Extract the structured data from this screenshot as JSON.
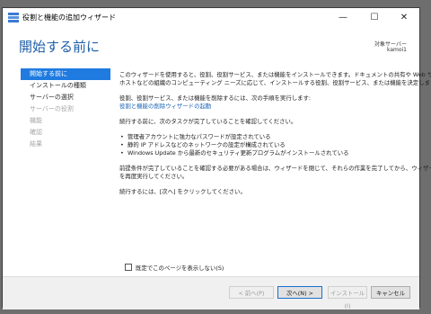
{
  "window": {
    "title": "役割と機能の追加ウィザード",
    "minimize": "—",
    "maximize": "☐",
    "close": "✕"
  },
  "header": {
    "page_title": "開始する前に",
    "server_label": "対象サーバー",
    "server_name": "kamoi1"
  },
  "nav": {
    "items": [
      {
        "label": "開始する前に",
        "state": "active"
      },
      {
        "label": "インストールの種類",
        "state": "enabled"
      },
      {
        "label": "サーバーの選択",
        "state": "enabled"
      },
      {
        "label": "サーバーの役割",
        "state": "disabled"
      },
      {
        "label": "機能",
        "state": "disabled"
      },
      {
        "label": "確認",
        "state": "disabled"
      },
      {
        "label": "結果",
        "state": "disabled"
      }
    ]
  },
  "main": {
    "intro_line1": "このウィザードを使用すると、役割、役割サービス、または機能をインストールできます。ドキュメントの共有や Web サイトの",
    "intro_line2": "ホストなどの組織のコンピューティング ニーズに応じて、インストールする役割、役割サービス、または機能を決定します。",
    "remove_text": "役割、役割サービス、または機能を削除するには、次の手順を実行します:",
    "remove_link": "役割と機能の削除ウィザードの起動",
    "tasks_intro": "続行する前に、次のタスクが完了していることを確認してください。",
    "bullets": [
      "管理者アカウントに強力なパスワードが設定されている",
      "静的 IP アドレスなどのネットワークの設定が構成されている",
      "Windows Update から最新のセキュリティ更新プログラムがインストールされている"
    ],
    "prereq_line1": "前提条件が完了していることを確認する必要がある場合は、ウィザードを閉じて、それらの作業を完了してから、ウィザード",
    "prereq_line2": "を再度実行してください。",
    "continue_text": "続行するには、[次へ] をクリックしてください。",
    "skip_checkbox": "既定でこのページを表示しない(S)"
  },
  "footer": {
    "prev": "< 前へ(P)",
    "next": "次へ(N) >",
    "install": "インストール(I)",
    "cancel": "キャンセル"
  },
  "colors": {
    "accent": "#1f7be0",
    "title": "#1f5fa8",
    "link": "#1a62b4"
  }
}
